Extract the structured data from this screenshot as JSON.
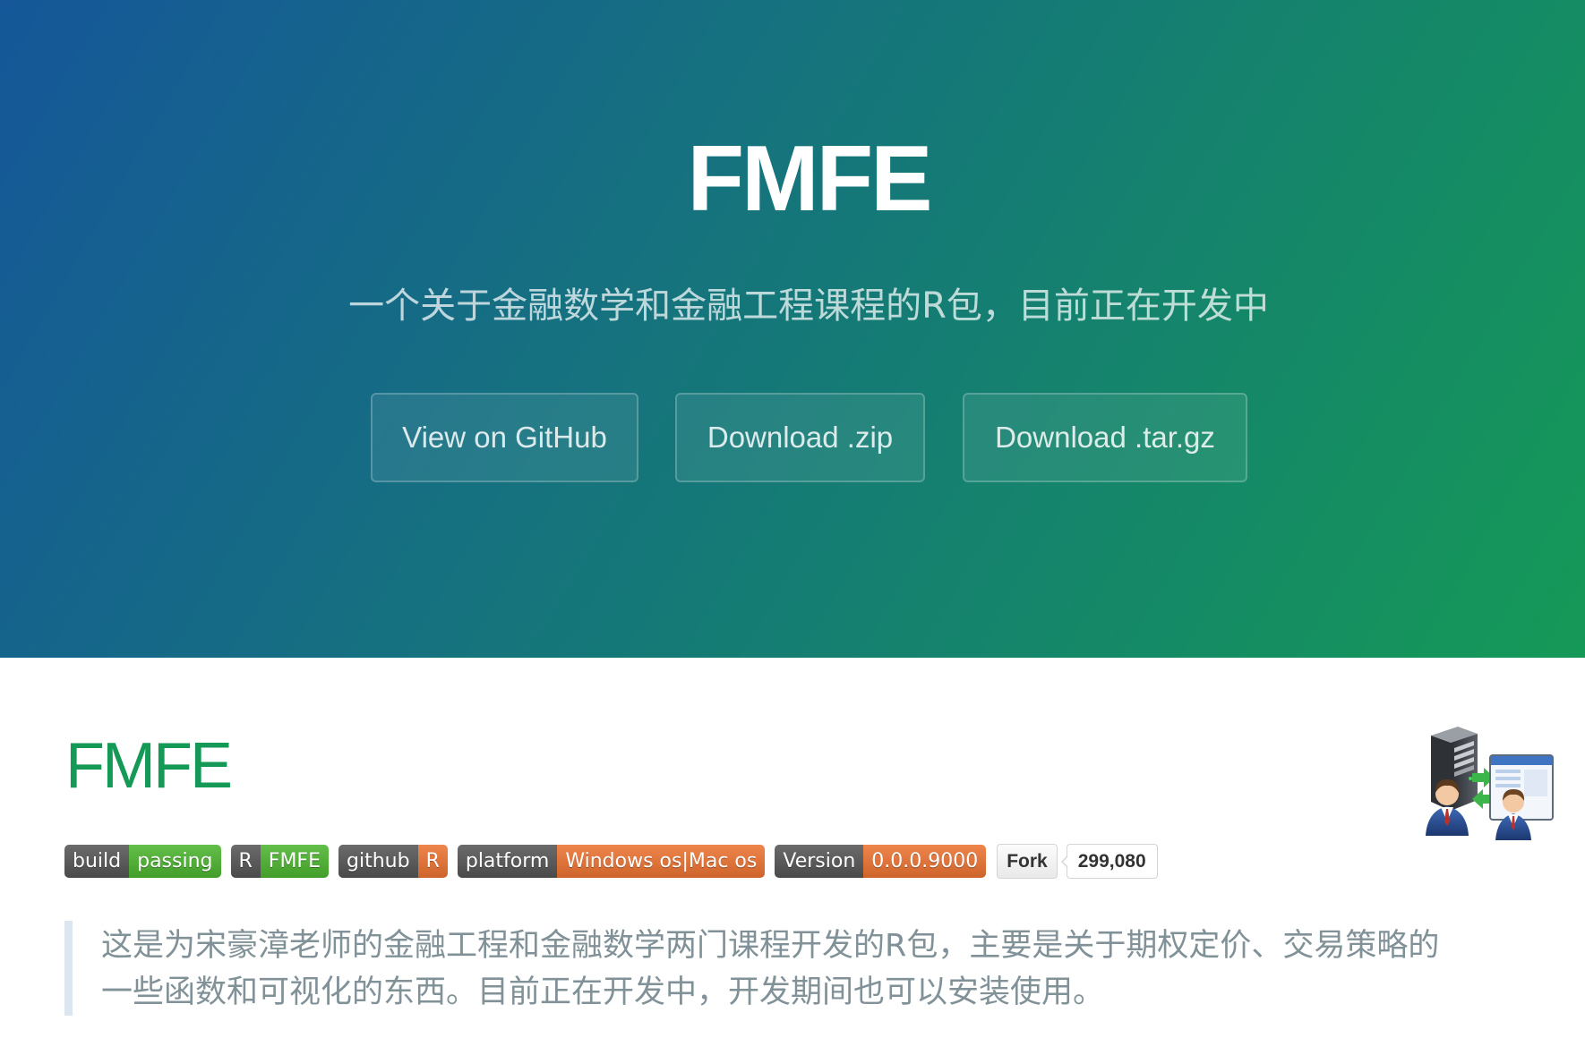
{
  "theme": {
    "header_gradient_from": "#155799",
    "header_gradient_to": "#159957",
    "heading_color": "#159957",
    "quote_text_color": "#819198",
    "quote_border_color": "#dce6f0"
  },
  "header": {
    "title": "FMFE",
    "tagline": "一个关于金融数学和金融工程课程的R包，目前正在开发中",
    "buttons": [
      {
        "label": "View on GitHub"
      },
      {
        "label": "Download .zip"
      },
      {
        "label": "Download .tar.gz"
      }
    ]
  },
  "main": {
    "heading": "FMFE",
    "logo_icon": "server-client-icon",
    "badges": [
      {
        "label": "build",
        "value": "passing",
        "label_color": "#555555",
        "value_color": "#4cb52f"
      },
      {
        "label": "R",
        "value": "FMFE",
        "label_color": "#555555",
        "value_color": "#4cb52f"
      },
      {
        "label": "github",
        "value": "R",
        "label_color": "#555555",
        "value_color": "#ec7331"
      },
      {
        "label": "platform",
        "value": "Windows os|Mac os",
        "label_color": "#555555",
        "value_color": "#ec7331"
      },
      {
        "label": "Version",
        "value": "0.0.0.9000",
        "label_color": "#555555",
        "value_color": "#ec7331"
      }
    ],
    "fork_button": {
      "label": "Fork",
      "count": "299,080"
    },
    "description": "这是为宋豪漳老师的金融工程和金融数学两门课程开发的R包，主要是关于期权定价、交易策略的一些函数和可视化的东西。目前正在开发中，开发期间也可以安装使用。"
  }
}
